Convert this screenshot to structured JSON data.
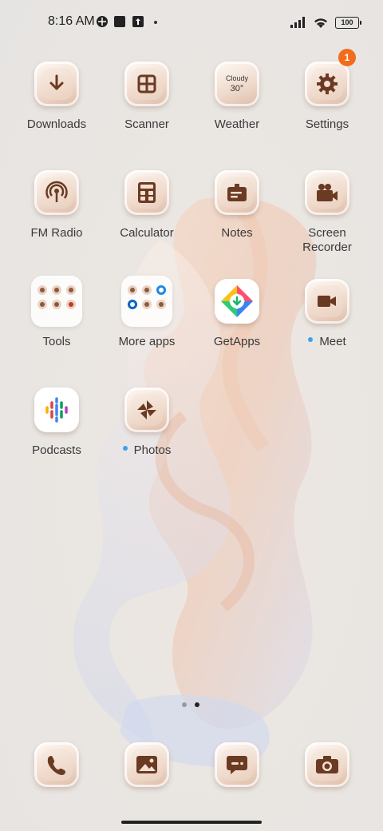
{
  "status": {
    "time": "8:16 AM",
    "battery": "100"
  },
  "apps": {
    "downloads": {
      "label": "Downloads",
      "icon": "download-arrow-icon"
    },
    "scanner": {
      "label": "Scanner",
      "icon": "scan-frame-icon"
    },
    "weather": {
      "label": "Weather",
      "icon": "weather-widget",
      "condition": "Cloudy",
      "temp": "30°"
    },
    "settings": {
      "label": "Settings",
      "icon": "gear-icon",
      "badge": "1"
    },
    "fm_radio": {
      "label": "FM Radio",
      "icon": "radio-broadcast-icon"
    },
    "calculator": {
      "label": "Calculator",
      "icon": "calculator-icon"
    },
    "notes": {
      "label": "Notes",
      "icon": "notes-icon"
    },
    "screen_recorder": {
      "label": "Screen\nRecorder",
      "icon": "video-camera-icon"
    },
    "tools": {
      "label": "Tools",
      "icon": "folder"
    },
    "more_apps": {
      "label": "More apps",
      "icon": "folder"
    },
    "getapps": {
      "label": "GetApps",
      "icon": "getapps-icon"
    },
    "meet": {
      "label": "Meet",
      "icon": "video-icon"
    },
    "podcasts": {
      "label": "Podcasts",
      "icon": "podcasts-icon"
    },
    "photos": {
      "label": "Photos",
      "icon": "pinwheel-icon"
    }
  },
  "dock": [
    {
      "name": "phone",
      "icon": "phone-icon"
    },
    {
      "name": "gallery",
      "icon": "gallery-icon"
    },
    {
      "name": "messages",
      "icon": "message-icon"
    },
    {
      "name": "camera",
      "icon": "camera-icon"
    }
  ],
  "colors": {
    "accent_brown": "#6b3a22",
    "badge": "#f36b1c",
    "new_app_dot": "#3aa3e8"
  }
}
